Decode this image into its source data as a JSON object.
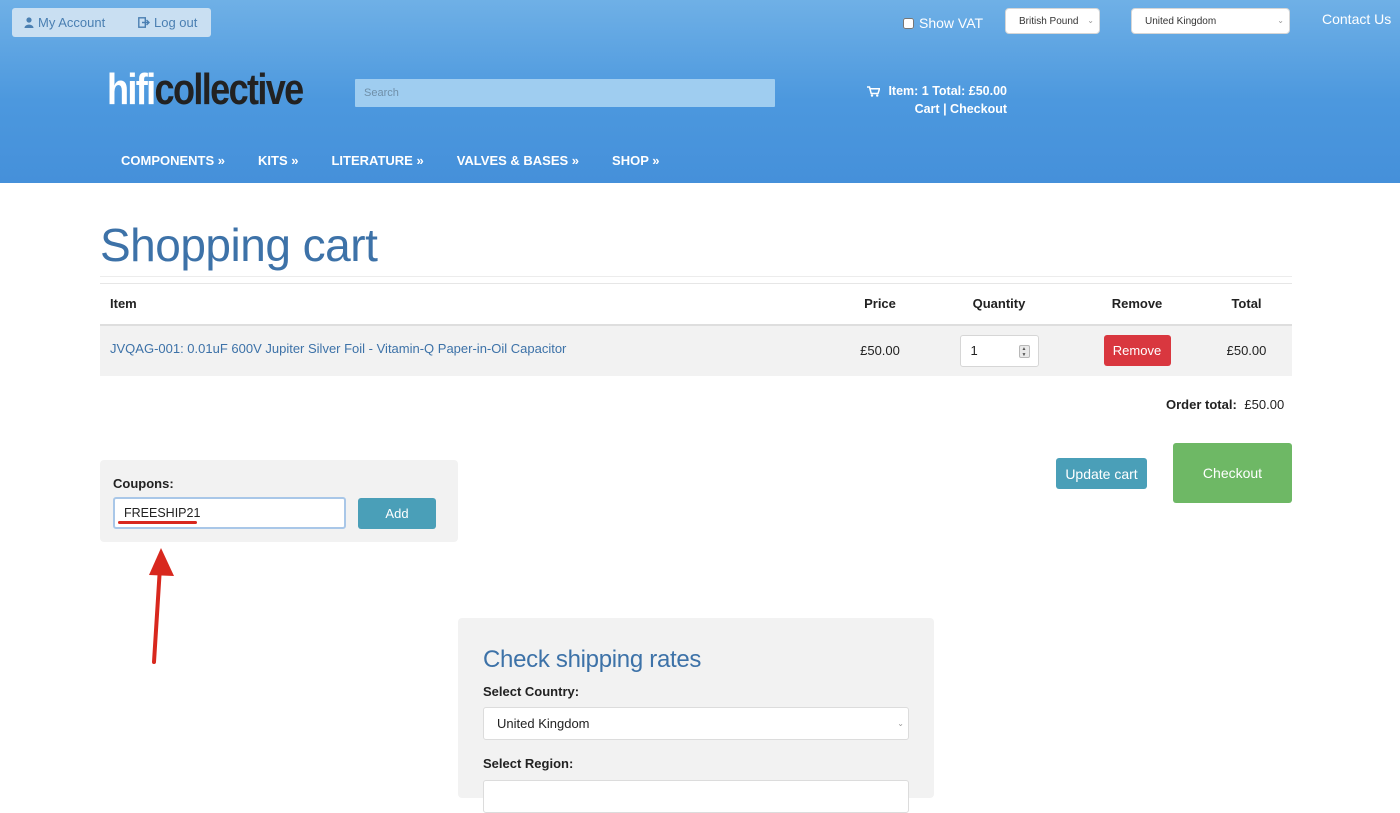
{
  "header": {
    "account": {
      "my_account": "My Account",
      "log_out": "Log out"
    },
    "show_vat_label": "Show VAT",
    "currency_select": "British Pound",
    "country_select": "United Kingdom",
    "contact_us": "Contact Us",
    "logo": {
      "part1": "hifi",
      "part2": "collective"
    },
    "search_placeholder": "Search",
    "cart_summary": {
      "line": "Item: 1 Total: £50.00",
      "cart_link": "Cart",
      "separator": "|",
      "checkout_link": "Checkout"
    },
    "nav": [
      "COMPONENTS »",
      "KITS »",
      "LITERATURE »",
      "VALVES & BASES »",
      "SHOP »"
    ]
  },
  "page_title": "Shopping cart",
  "cart": {
    "columns": {
      "item": "Item",
      "price": "Price",
      "quantity": "Quantity",
      "remove": "Remove",
      "total": "Total"
    },
    "rows": [
      {
        "item": "JVQAG-001: 0.01uF 600V Jupiter Silver Foil - Vitamin-Q Paper-in-Oil Capacitor",
        "price": "£50.00",
        "quantity": "1",
        "remove_label": "Remove",
        "total": "£50.00"
      }
    ],
    "order_total_label": "Order total:",
    "order_total_value": "£50.00",
    "update_cart": "Update cart",
    "checkout": "Checkout"
  },
  "coupons": {
    "label": "Coupons:",
    "value": "FREESHIP21",
    "add": "Add"
  },
  "shipping": {
    "title": "Check shipping rates",
    "country_label": "Select Country:",
    "country_value": "United Kingdom",
    "region_label": "Select Region:"
  },
  "colors": {
    "header_blue": "#4c98de",
    "title_blue": "#3d72a8",
    "remove_red": "#d9373f",
    "action_teal": "#4a9fb8",
    "checkout_green": "#6eb865",
    "annotation_red": "#d8281e"
  }
}
